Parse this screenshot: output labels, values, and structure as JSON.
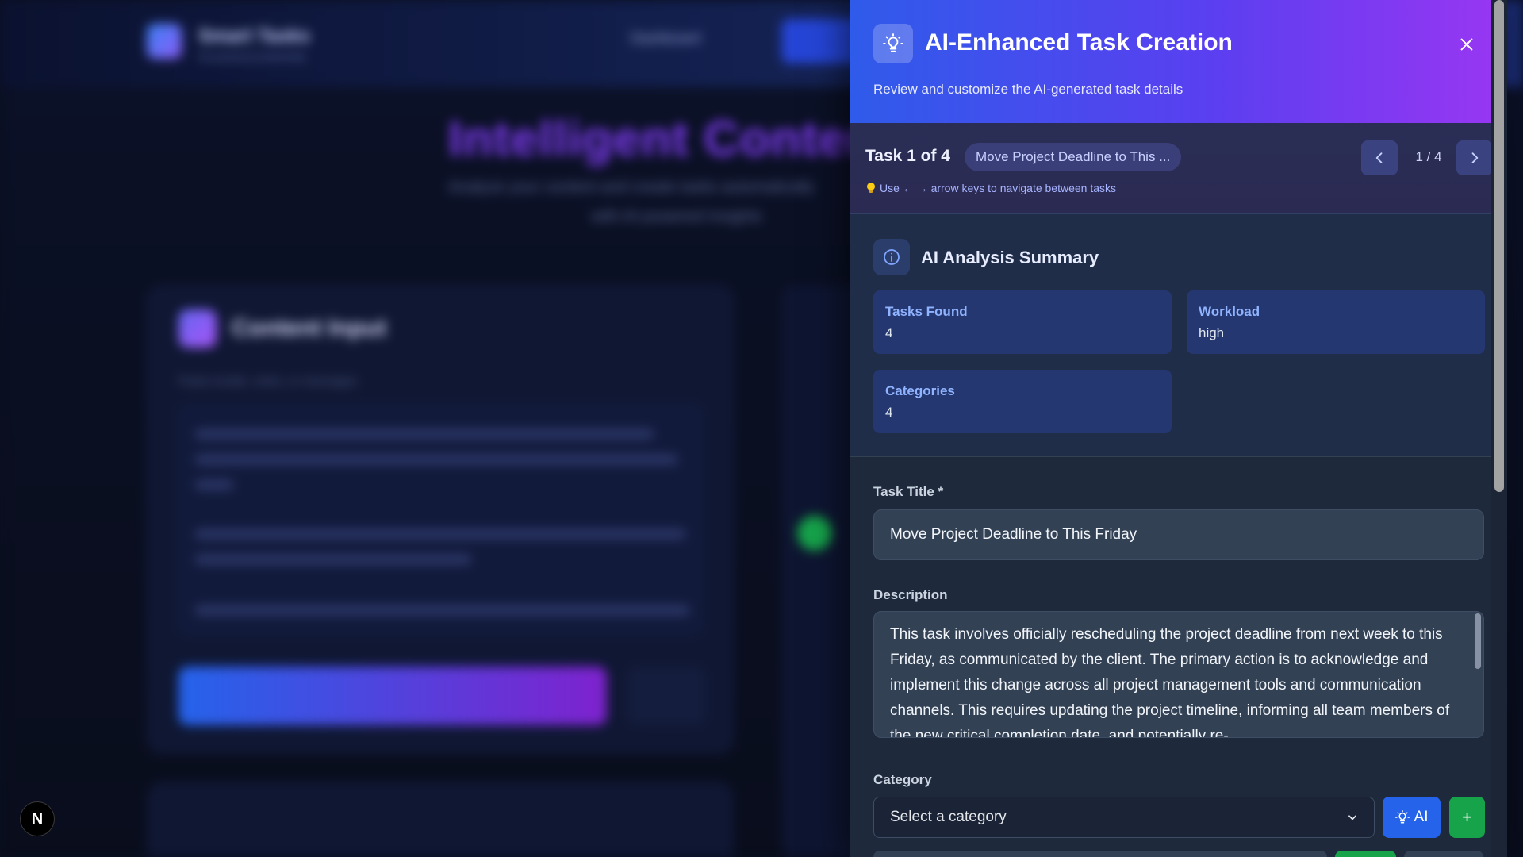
{
  "background": {
    "brand": "Smart Tasks",
    "brand_sub": "AI-powered productivity",
    "nav_link": "Dashboard",
    "hero": "Intelligent Content",
    "hero_sub": "Analyze your content and create tasks automatically",
    "hero_sub2": "with AI-powered insights",
    "card_title": "Content Input",
    "card_sub": "Paste emails, notes, or messages"
  },
  "next_badge": "N",
  "drawer": {
    "title": "AI-Enhanced Task Creation",
    "subtitle": "Review and customize the AI-generated task details",
    "icons": {
      "header": "lightbulb-icon",
      "close": "close-icon"
    }
  },
  "task_nav": {
    "count_label": "Task 1 of 4",
    "current_task_pill": "Move Project Deadline to This ...",
    "page_indicator": "1 / 4",
    "hint": "Use ← → arrow keys to navigate between tasks"
  },
  "summary": {
    "title": "AI Analysis Summary",
    "stats": [
      {
        "label": "Tasks Found",
        "value": "4"
      },
      {
        "label": "Workload",
        "value": "high"
      },
      {
        "label": "Categories",
        "value": "4"
      }
    ]
  },
  "form": {
    "title_label": "Task Title *",
    "title_value": "Move Project Deadline to This Friday",
    "description_label": "Description",
    "description_value": "This task involves officially rescheduling the project deadline from next week to this Friday, as communicated by the client. The primary action is to acknowledge and implement this change across all project management tools and communication channels. This requires updating the project timeline, informing all team members of the new critical completion date, and potentially re-",
    "category_label": "Category",
    "category_value": "Select a category",
    "ai_button": "AI",
    "add_button": "+"
  },
  "colors": {
    "header_gradient_start": "#2f5bea",
    "header_gradient_end": "#9a36f2",
    "stat_card": "#243770",
    "ai_button": "#2563eb",
    "add_button": "#16a34a"
  }
}
